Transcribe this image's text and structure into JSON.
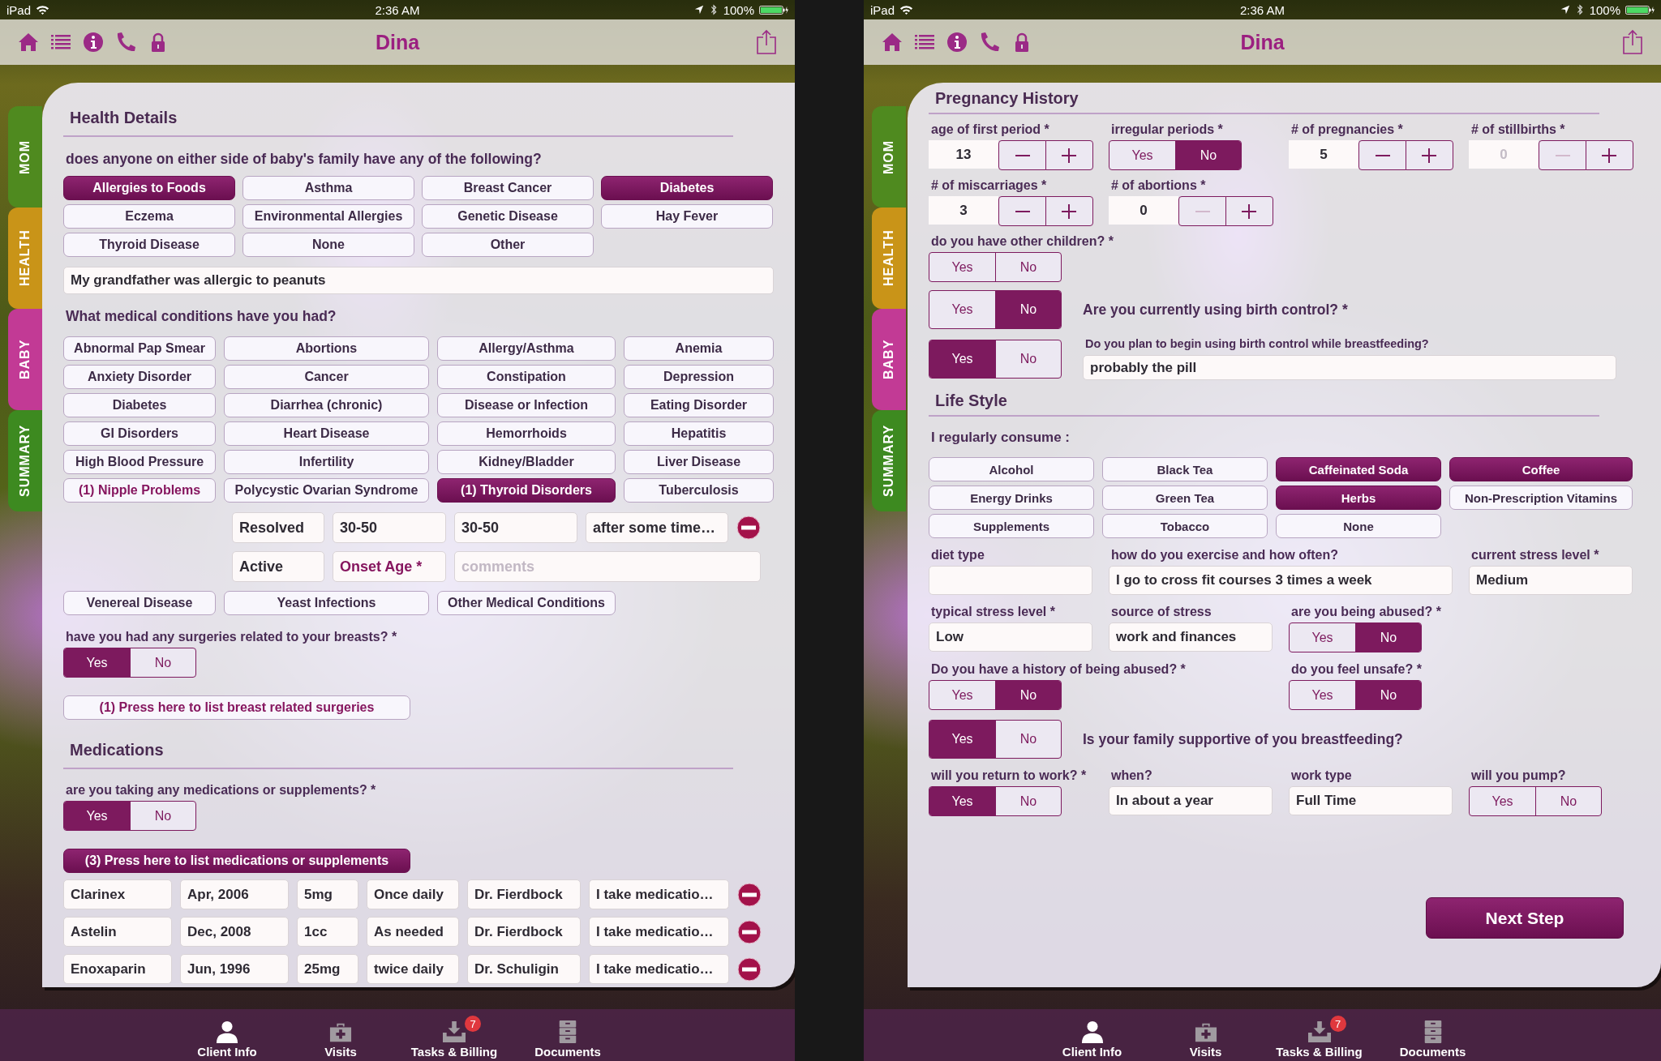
{
  "screens": [
    {
      "kind": "health",
      "status_bar": {
        "device": "iPad",
        "time": "2:36 AM",
        "battery": "100%"
      },
      "nav": {
        "title": "Dina"
      },
      "side_tabs": [
        {
          "label": "MOM",
          "color": "#4f8a1f"
        },
        {
          "label": "HEALTH",
          "color": "#c99418"
        },
        {
          "label": "BABY",
          "color": "#c23a95"
        },
        {
          "label": "SUMMARY",
          "color": "#3d8a20"
        }
      ],
      "health": {
        "title": "Health Details",
        "family_question": "does anyone on either side of baby's family have any of the following?",
        "family_options": [
          {
            "label": "Allergies to Foods",
            "selected": true
          },
          {
            "label": "Asthma",
            "selected": false
          },
          {
            "label": "Breast Cancer",
            "selected": false
          },
          {
            "label": "Diabetes",
            "selected": true
          },
          {
            "label": "Eczema",
            "selected": false
          },
          {
            "label": "Environmental Allergies",
            "selected": false
          },
          {
            "label": "Genetic Disease",
            "selected": false
          },
          {
            "label": "Hay Fever",
            "selected": false
          },
          {
            "label": "Thyroid Disease",
            "selected": false
          },
          {
            "label": "None",
            "selected": false
          },
          {
            "label": "Other",
            "selected": false
          }
        ],
        "family_note": "My grandfather was allergic to peanuts",
        "conditions_question": "What medical conditions have you had?",
        "conditions": [
          {
            "label": "Abnormal Pap Smear",
            "selected": false,
            "has_entries": false
          },
          {
            "label": "Abortions",
            "selected": false,
            "has_entries": false
          },
          {
            "label": "Allergy/Asthma",
            "selected": false,
            "has_entries": false
          },
          {
            "label": "Anemia",
            "selected": false,
            "has_entries": false
          },
          {
            "label": "Anxiety Disorder",
            "selected": false,
            "has_entries": false
          },
          {
            "label": "Cancer",
            "selected": false,
            "has_entries": false
          },
          {
            "label": "Constipation",
            "selected": false,
            "has_entries": false
          },
          {
            "label": "Depression",
            "selected": false,
            "has_entries": false
          },
          {
            "label": "Diabetes",
            "selected": false,
            "has_entries": false
          },
          {
            "label": "Diarrhea (chronic)",
            "selected": false,
            "has_entries": false
          },
          {
            "label": "Disease or Infection",
            "selected": false,
            "has_entries": false
          },
          {
            "label": "Eating Disorder",
            "selected": false,
            "has_entries": false
          },
          {
            "label": "GI Disorders",
            "selected": false,
            "has_entries": false
          },
          {
            "label": "Heart Disease",
            "selected": false,
            "has_entries": false
          },
          {
            "label": "Hemorrhoids",
            "selected": false,
            "has_entries": false
          },
          {
            "label": "Hepatitis",
            "selected": false,
            "has_entries": false
          },
          {
            "label": "High Blood Pressure",
            "selected": false,
            "has_entries": false
          },
          {
            "label": "Infertility",
            "selected": false,
            "has_entries": false
          },
          {
            "label": "Kidney/Bladder",
            "selected": false,
            "has_entries": false
          },
          {
            "label": "Liver Disease",
            "selected": false,
            "has_entries": false
          },
          {
            "label": "(1) Nipple Problems",
            "selected": false,
            "has_entries": true
          },
          {
            "label": "Polycystic Ovarian Syndrome",
            "selected": false,
            "has_entries": false
          },
          {
            "label": "(1) Thyroid Disorders",
            "selected": true
          },
          {
            "label": "Tuberculosis",
            "selected": false,
            "has_entries": false
          }
        ],
        "condition_entry": [
          {
            "removable": true,
            "cells": [
              {
                "kind": "value",
                "text": "Resolved"
              },
              {
                "kind": "value",
                "text": "30-50"
              },
              {
                "kind": "value",
                "text": "30-50"
              },
              {
                "kind": "value",
                "text": "after some time…"
              }
            ]
          },
          {
            "cells": [
              {
                "kind": "value",
                "text": "Active"
              },
              {
                "kind": "picker",
                "text": "Onset Age *"
              },
              {
                "kind": "placeholder",
                "placeholder": "comments"
              }
            ]
          }
        ],
        "more_conditions": [
          {
            "label": "Venereal Disease",
            "selected": false,
            "has_entries": false
          },
          {
            "label": "Yeast Infections",
            "selected": false,
            "has_entries": false
          },
          {
            "label": "Other Medical Conditions",
            "selected": false,
            "has_entries": false
          }
        ],
        "surgery_question": "have you had any surgeries related to your breasts? *",
        "surgery_answer": [
          {
            "label": "Yes",
            "selected": true
          },
          {
            "label": "No",
            "selected": false
          }
        ],
        "surgery_button": {
          "label": "(1) Press here to list breast related surgeries",
          "kind": "outline"
        },
        "medications_title": "Medications",
        "medication_question": "are you taking any medications or supplements? *",
        "medication_answer": [
          {
            "label": "Yes",
            "selected": true
          },
          {
            "label": "No",
            "selected": false
          }
        ],
        "medication_button": {
          "label": "(3) Press here to list medications or supplements",
          "kind": "filled"
        },
        "medications": [
          {
            "removable": true,
            "cells": [
              "Clarinex",
              "Apr, 2006",
              "5mg",
              "Once daily",
              "Dr. Fierdbock",
              "I take medicatio…"
            ]
          },
          {
            "removable": true,
            "cells": [
              "Astelin",
              "Dec, 2008",
              "1cc",
              "As needed",
              "Dr. Fierdbock",
              "I take medicatio…"
            ]
          },
          {
            "removable": true,
            "cells": [
              "Enoxaparin",
              "Jun, 1996",
              "25mg",
              "twice daily",
              "Dr. Schuligin",
              "I take medicatio…"
            ]
          }
        ]
      },
      "tab_bar": [
        {
          "label": "Client Info",
          "selected": true
        },
        {
          "label": "Visits",
          "selected": false
        },
        {
          "label": "Tasks & Billing",
          "selected": false,
          "badge": "7"
        },
        {
          "label": "Documents",
          "selected": false
        }
      ]
    },
    {
      "kind": "pregnancy",
      "status_bar": {
        "device": "iPad",
        "time": "2:36 AM",
        "battery": "100%"
      },
      "nav": {
        "title": "Dina"
      },
      "side_tabs": [
        {
          "label": "MOM",
          "color": "#4f8a1f"
        },
        {
          "label": "HEALTH",
          "color": "#c99418"
        },
        {
          "label": "BABY",
          "color": "#c23a95"
        },
        {
          "label": "SUMMARY",
          "color": "#3d8a20"
        }
      ],
      "pregnancy": {
        "history_title": "Pregnancy History",
        "history_rows": [
          [
            {
              "kind": "stepper",
              "label": "age of first period *",
              "value": "13",
              "disabled": false,
              "minus_disabled": false
            },
            {
              "kind": "choice",
              "label": "irregular periods *",
              "options": [
                {
                  "label": "Yes",
                  "selected": false
                },
                {
                  "label": "No",
                  "selected": true
                }
              ]
            },
            {
              "kind": "stepper",
              "label": "# of pregnancies *",
              "value": "5",
              "disabled": false,
              "minus_disabled": false
            },
            {
              "kind": "stepper",
              "label": "# of stillbirths *",
              "value": "0",
              "disabled": true,
              "minus_disabled": true
            }
          ],
          [
            {
              "kind": "stepper",
              "label": "# of miscarriages *",
              "value": "3",
              "disabled": false,
              "minus_disabled": false
            },
            {
              "kind": "stepper",
              "label": "# of abortions *",
              "value": "0",
              "disabled": false,
              "minus_disabled": true
            }
          ],
          [
            {
              "kind": "choice",
              "label": "do you have other children? *",
              "options": [
                {
                  "label": "Yes",
                  "selected": false
                },
                {
                  "label": "No",
                  "selected": false
                }
              ]
            }
          ],
          [
            {
              "kind": "choice_question",
              "question": "Are you currently using birth control? *",
              "options": [
                {
                  "label": "Yes",
                  "selected": false
                },
                {
                  "label": "No",
                  "selected": true
                }
              ]
            }
          ],
          [
            {
              "kind": "choice_field",
              "question": "Do you plan to begin using birth control while breastfeeding?",
              "value": "probably the pill",
              "options": [
                {
                  "label": "Yes",
                  "selected": true
                },
                {
                  "label": "No",
                  "selected": false
                }
              ]
            }
          ]
        ],
        "lifestyle_title": "Life Style",
        "consume_label": "I regularly consume :",
        "consume_options": [
          {
            "label": "Alcohol",
            "selected": false
          },
          {
            "label": "Black Tea",
            "selected": false
          },
          {
            "label": "Caffeinated Soda",
            "selected": true
          },
          {
            "label": "Coffee",
            "selected": true
          },
          {
            "label": "Energy Drinks",
            "selected": false
          },
          {
            "label": "Green Tea",
            "selected": false
          },
          {
            "label": "Herbs",
            "selected": true
          },
          {
            "label": "Non-Prescription Vitamins",
            "selected": false
          },
          {
            "label": "Supplements",
            "selected": false
          },
          {
            "label": "Tobacco",
            "selected": false
          },
          {
            "label": "None",
            "selected": false
          }
        ],
        "lifestyle_rows": [
          [
            {
              "kind": "field",
              "label": "diet type"
            },
            {
              "kind": "field",
              "label": "how do you exercise and how often?",
              "value": "I go to cross fit courses 3 times a week",
              "wide": true
            },
            {
              "kind": "field",
              "label": "current stress level *",
              "value": "Medium"
            }
          ],
          [
            {
              "kind": "field",
              "label": "typical stress level *",
              "value": "Low"
            },
            {
              "kind": "field",
              "label": "source of stress",
              "value": "work and finances"
            },
            {
              "kind": "choice",
              "label": "are you being abused? *",
              "options": [
                {
                  "label": "Yes",
                  "selected": false
                },
                {
                  "label": "No",
                  "selected": true
                }
              ]
            }
          ],
          [
            {
              "kind": "choice",
              "label": "Do you have a history of being abused? *",
              "wide": true,
              "options": [
                {
                  "label": "Yes",
                  "selected": false
                },
                {
                  "label": "No",
                  "selected": true
                }
              ]
            },
            {
              "kind": "choice",
              "label": "do you feel unsafe? *",
              "options": [
                {
                  "label": "Yes",
                  "selected": false
                },
                {
                  "label": "No",
                  "selected": true
                }
              ]
            }
          ],
          [
            {
              "kind": "choice_question",
              "question": "Is your family supportive of you breastfeeding?",
              "options": [
                {
                  "label": "Yes",
                  "selected": true
                },
                {
                  "label": "No",
                  "selected": false
                }
              ]
            }
          ],
          [
            {
              "kind": "choice",
              "label": "will you return to work? *",
              "options": [
                {
                  "label": "Yes",
                  "selected": true
                },
                {
                  "label": "No",
                  "selected": false
                }
              ]
            },
            {
              "kind": "field",
              "label": "when?",
              "value": "In about a year"
            },
            {
              "kind": "field",
              "label": "work type",
              "value": "Full Time"
            },
            {
              "kind": "choice",
              "label": "will you pump?",
              "options": [
                {
                  "label": "Yes",
                  "selected": false
                },
                {
                  "label": "No",
                  "selected": false
                }
              ]
            }
          ]
        ],
        "next_button": "Next Step"
      },
      "tab_bar": [
        {
          "label": "Client Info",
          "selected": true
        },
        {
          "label": "Visits",
          "selected": false
        },
        {
          "label": "Tasks & Billing",
          "selected": false,
          "badge": "7"
        },
        {
          "label": "Documents",
          "selected": false
        }
      ]
    }
  ]
}
